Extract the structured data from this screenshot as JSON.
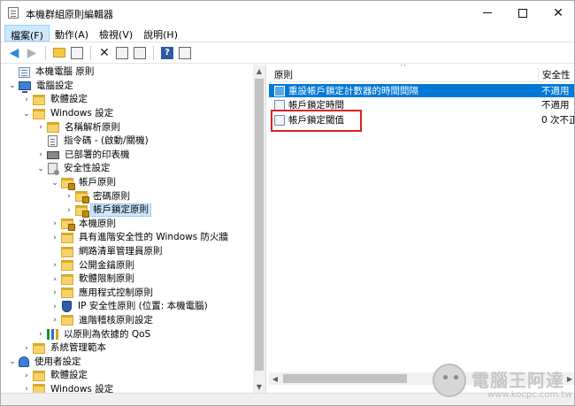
{
  "window": {
    "title": "本機群組原則編輯器",
    "controls": {
      "minimize": "—",
      "maximize": "☐",
      "close": "✕"
    }
  },
  "menu": [
    "檔案(F)",
    "動作(A)",
    "檢視(V)",
    "說明(H)"
  ],
  "toolbar": {
    "icons": [
      "back-arrow-icon",
      "forward-arrow-icon",
      "folder-up-icon",
      "show-hide-tree-icon",
      "delete-icon",
      "properties-icon",
      "export-list-icon",
      "help-icon",
      "view-icon"
    ],
    "help_label": "?"
  },
  "tree": [
    {
      "label": "本機電腦 原則",
      "level": 0,
      "toggle": "",
      "icon": "policy"
    },
    {
      "label": "電腦設定",
      "level": 0,
      "toggle": "v",
      "icon": "computer"
    },
    {
      "label": "軟體設定",
      "level": 1,
      "toggle": ">",
      "icon": "folder"
    },
    {
      "label": "Windows 設定",
      "level": 1,
      "toggle": "v",
      "icon": "folder"
    },
    {
      "label": "名稱解析原則",
      "level": 2,
      "toggle": ">",
      "icon": "folder"
    },
    {
      "label": "指令碼 - (啟動/關機)",
      "level": 2,
      "toggle": "",
      "icon": "doc"
    },
    {
      "label": "已部署的印表機",
      "level": 2,
      "toggle": ">",
      "icon": "printer"
    },
    {
      "label": "安全性設定",
      "level": 2,
      "toggle": "v",
      "icon": "settings"
    },
    {
      "label": "帳戶原則",
      "level": 3,
      "toggle": "v",
      "icon": "folder-lock"
    },
    {
      "label": "密碼原則",
      "level": 4,
      "toggle": ">",
      "icon": "folder-lock"
    },
    {
      "label": "帳戶鎖定原則",
      "level": 4,
      "toggle": ">",
      "icon": "folder-lock",
      "selected": true
    },
    {
      "label": "本機原則",
      "level": 3,
      "toggle": ">",
      "icon": "folder-lock"
    },
    {
      "label": "具有進階安全性的 Windows 防火牆",
      "level": 3,
      "toggle": ">",
      "icon": "folder"
    },
    {
      "label": "網路清單管理員原則",
      "level": 3,
      "toggle": "",
      "icon": "folder"
    },
    {
      "label": "公開金鑰原則",
      "level": 3,
      "toggle": ">",
      "icon": "folder"
    },
    {
      "label": "軟體限制原則",
      "level": 3,
      "toggle": ">",
      "icon": "folder"
    },
    {
      "label": "應用程式控制原則",
      "level": 3,
      "toggle": ">",
      "icon": "folder"
    },
    {
      "label": "IP 安全性原則 (位置: 本機電腦)",
      "level": 3,
      "toggle": ">",
      "icon": "shield"
    },
    {
      "label": "進階稽核原則設定",
      "level": 3,
      "toggle": ">",
      "icon": "folder"
    },
    {
      "label": "以原則為依據的 QoS",
      "level": 2,
      "toggle": ">",
      "icon": "chart"
    },
    {
      "label": "系統管理範本",
      "level": 1,
      "toggle": ">",
      "icon": "folder"
    },
    {
      "label": "使用者設定",
      "level": 0,
      "toggle": "v",
      "icon": "user"
    },
    {
      "label": "軟體設定",
      "level": 1,
      "toggle": ">",
      "icon": "folder"
    },
    {
      "label": "Windows 設定",
      "level": 1,
      "toggle": ">",
      "icon": "folder"
    }
  ],
  "right": {
    "columns": {
      "policy": "原則",
      "setting": "安全性"
    },
    "rows": [
      {
        "name": "重設帳戶鎖定計數器的時間間隔",
        "value": "不適用",
        "highlight": true
      },
      {
        "name": "帳戶鎖定時間",
        "value": "不適用",
        "highlight": false
      },
      {
        "name": "帳戶鎖定閾值",
        "value": "0 次不正",
        "highlight": false
      }
    ]
  },
  "watermark": {
    "text": "電腦王阿達",
    "url": "www.kocpc.com.tw"
  },
  "colors": {
    "selection": "#0078d7",
    "annotation": "#e02020",
    "tree_selection": "#cce8ff"
  }
}
